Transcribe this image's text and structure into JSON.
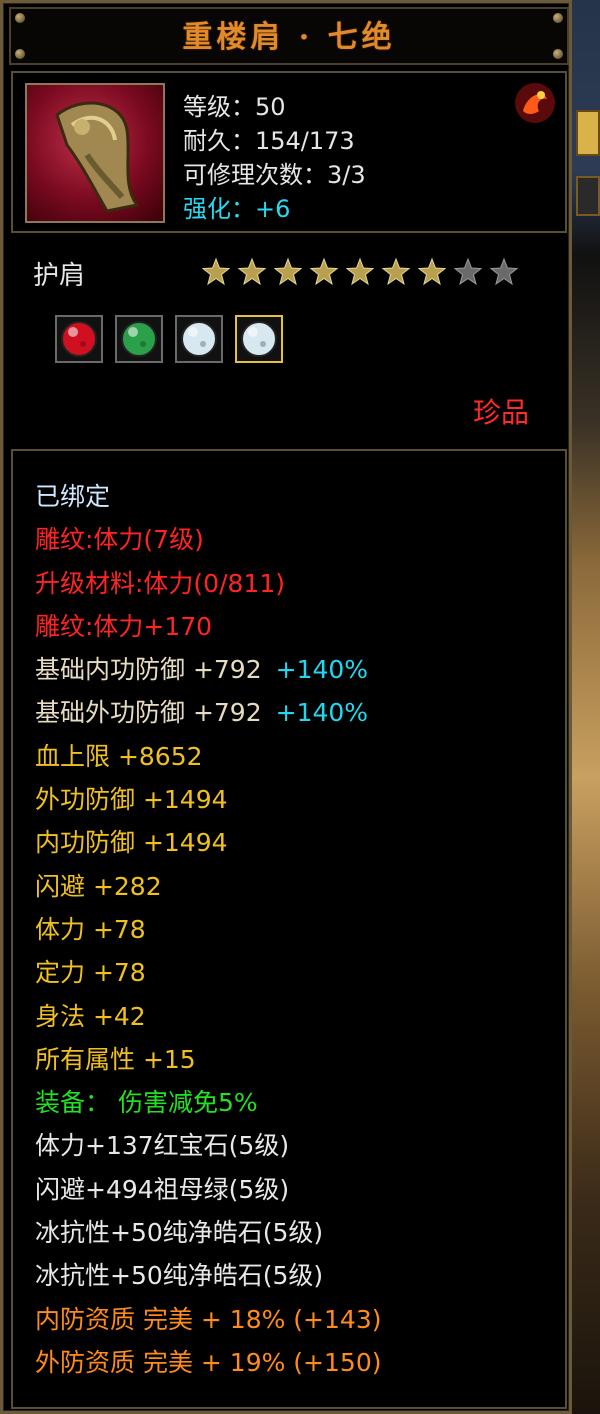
{
  "title": "重楼肩 · 七绝",
  "info": {
    "level": "等级：50",
    "durability": "耐久：154/173",
    "repair": "可修理次数：3/3",
    "enhance": "强化：+6"
  },
  "item_type": "护肩",
  "stars": {
    "filled": 7,
    "total": 9
  },
  "gems": [
    {
      "icon": "ruby-gem-icon",
      "color": "#d01020"
    },
    {
      "icon": "emerald-gem-icon",
      "color": "#2aa04a"
    },
    {
      "icon": "diamond-gem-icon",
      "color": "#d8e8f0"
    },
    {
      "icon": "diamond-gem-icon",
      "color": "#d8e8f0",
      "selected": true
    }
  ],
  "rarity": "珍品",
  "attributes": [
    {
      "text": "已绑定",
      "color": "cyan"
    },
    {
      "text": "雕纹:体力(7级)",
      "color": "red"
    },
    {
      "text": "升级材料:体力(0/811)",
      "color": "red"
    },
    {
      "text": "雕纹:体力+170",
      "color": "red"
    },
    {
      "text": "基础内功防御  +792",
      "color": "base",
      "extra": "+140%"
    },
    {
      "text": "基础外功防御  +792",
      "color": "base",
      "extra": "+140%"
    },
    {
      "text": "血上限  +8652",
      "color": "yellow"
    },
    {
      "text": "外功防御  +1494",
      "color": "yellow"
    },
    {
      "text": "内功防御  +1494",
      "color": "yellow"
    },
    {
      "text": "闪避  +282",
      "color": "yellow"
    },
    {
      "text": "体力  +78",
      "color": "yellow"
    },
    {
      "text": "定力  +78",
      "color": "yellow"
    },
    {
      "text": "身法  +42",
      "color": "yellow"
    },
    {
      "text": "所有属性  +15",
      "color": "yellow"
    },
    {
      "text": "装备：  伤害减免5%",
      "color": "green"
    },
    {
      "text": "体力+137红宝石(5级)",
      "color": "white"
    },
    {
      "text": "闪避+494祖母绿(5级)",
      "color": "white"
    },
    {
      "text": "冰抗性+50纯净皓石(5级)",
      "color": "white"
    },
    {
      "text": "冰抗性+50纯净皓石(5级)",
      "color": "white"
    },
    {
      "text": "内防资质  完美  +  18%  (+143)",
      "color": "orange"
    },
    {
      "text": "外防资质  完美  +  19%  (+150)",
      "color": "orange"
    }
  ]
}
